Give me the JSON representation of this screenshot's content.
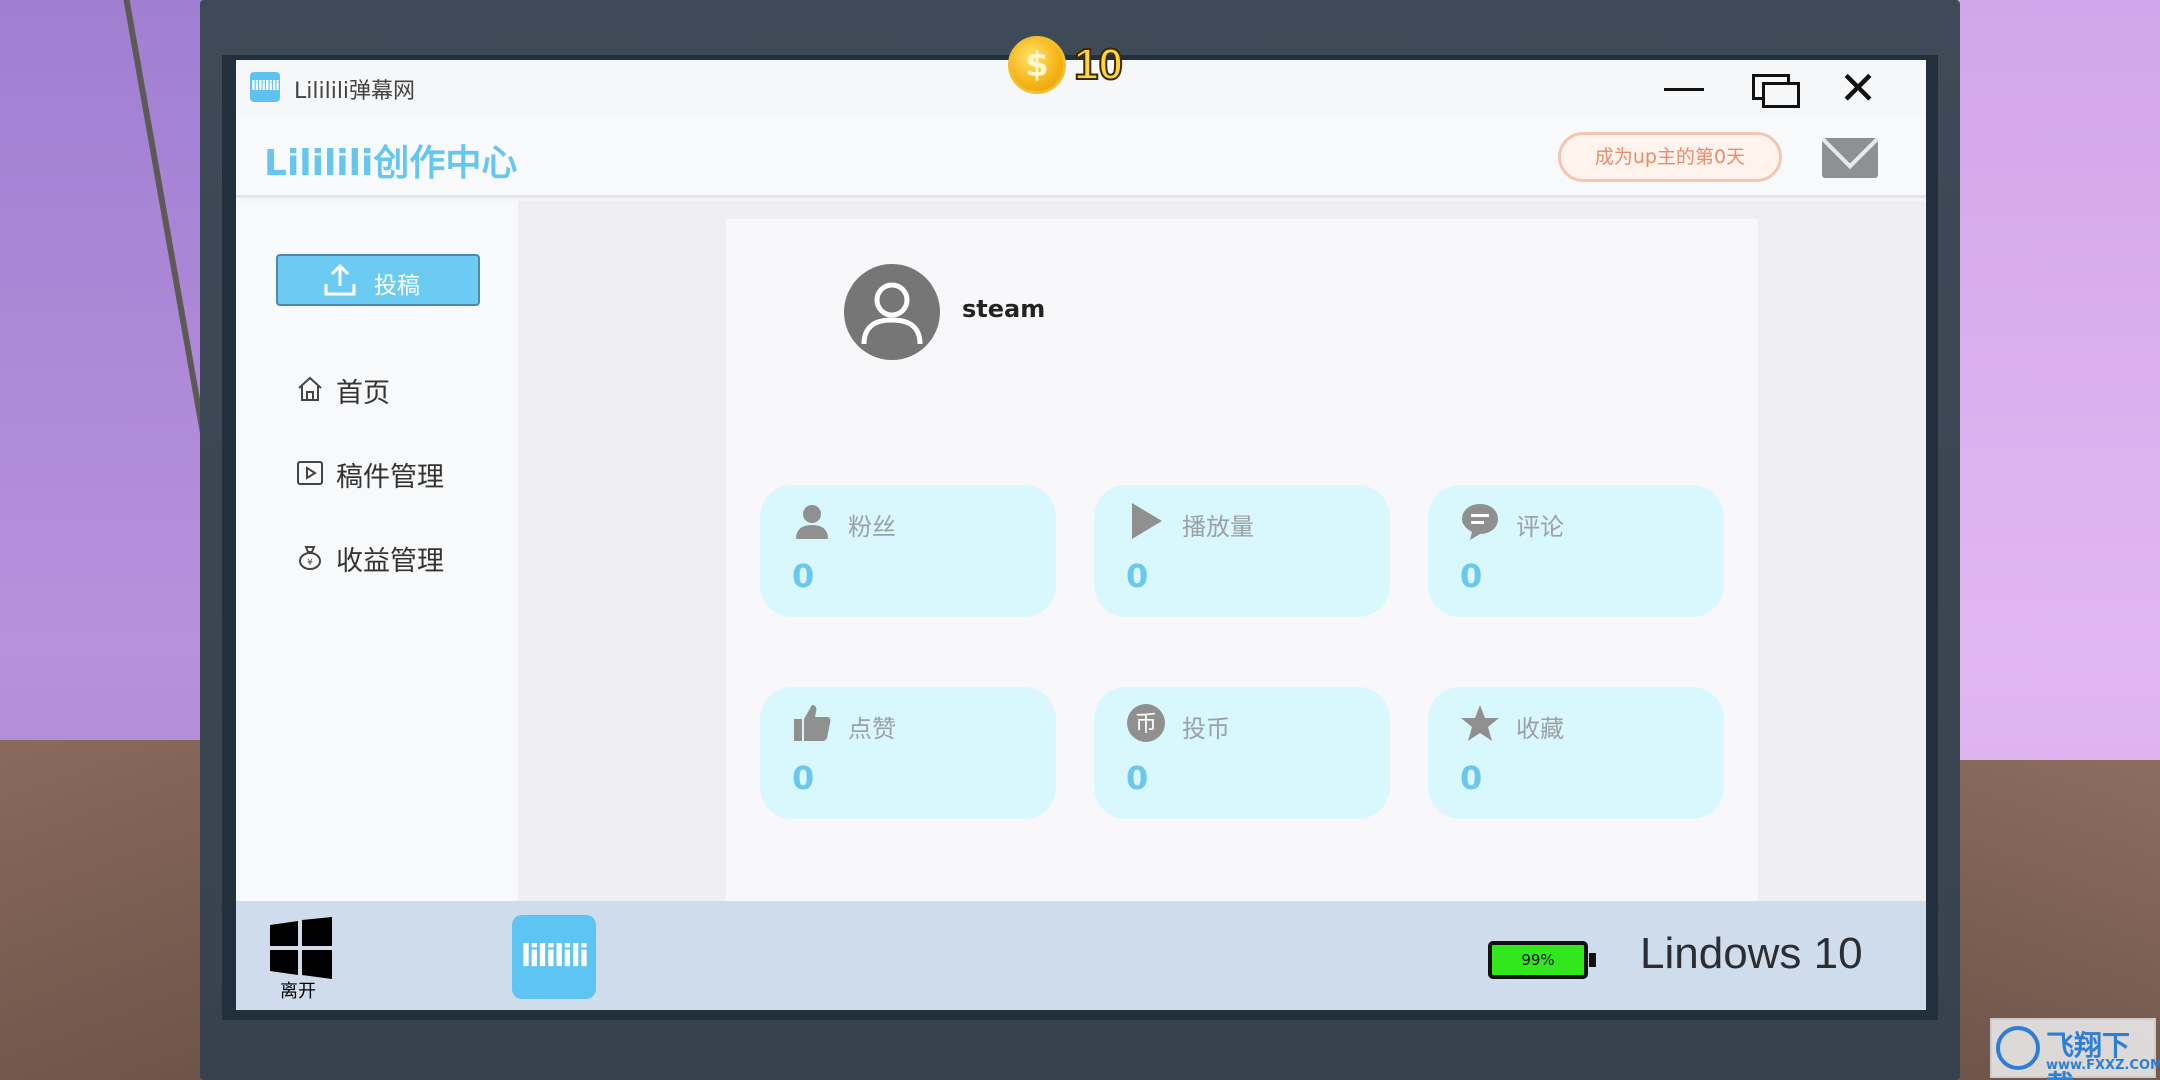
{
  "window": {
    "title": "Lililili弹幕网",
    "app_icon_text": "lililili"
  },
  "hud": {
    "coins": "10",
    "coin_symbol": "$"
  },
  "header": {
    "brand": "Lililili创作中心",
    "up_days_badge": "成为up主的第0天",
    "mail_icon": "mail-icon"
  },
  "sidebar": {
    "upload_label": "投稿",
    "items": [
      {
        "label": "首页",
        "icon": "home-icon"
      },
      {
        "label": "稿件管理",
        "icon": "video-icon"
      },
      {
        "label": "收益管理",
        "icon": "money-bag-icon"
      }
    ]
  },
  "profile": {
    "username": "steam"
  },
  "stats": [
    {
      "label": "粉丝",
      "value": "0",
      "icon": "person-icon"
    },
    {
      "label": "播放量",
      "value": "0",
      "icon": "play-icon"
    },
    {
      "label": "评论",
      "value": "0",
      "icon": "comment-icon"
    },
    {
      "label": "点赞",
      "value": "0",
      "icon": "thumbs-up-icon"
    },
    {
      "label": "投币",
      "value": "0",
      "icon": "coin-icon"
    },
    {
      "label": "收藏",
      "value": "0",
      "icon": "star-icon"
    }
  ],
  "taskbar": {
    "start_label": "离开",
    "app_icon_text": "lililili",
    "battery": "99%",
    "battery_level": 0.99,
    "os_name": "Lindows 10"
  },
  "watermark": {
    "text": "飞翔下载",
    "url": "www.FXXZ.COM"
  },
  "colors": {
    "accent": "#66c6ef",
    "stat_card_bg": "#d8f8fe",
    "badge_text": "#e98b6c",
    "battery_fill": "#32e81c"
  }
}
